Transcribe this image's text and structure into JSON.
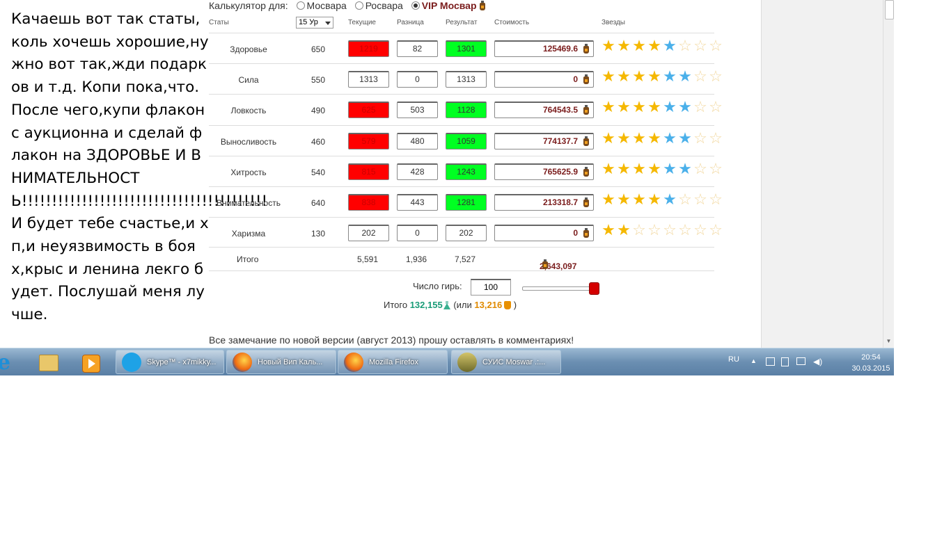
{
  "note": {
    "text": "Качаешь вот так статы,коль хочешь хорошие,нужно вот так,жди подарков и т.д. Копи пока,что. После чего,купи флакон с аукционна и сделай флакон на ЗДОРОВЬЕ И ВНИМАТЕЛЬНОСТЬ!!!!!!!!!!!!!!!!!!!!!!!!!!!!!!!!!!!!!!!!! И будет тебе счастье,и хп,и неуязвимость в боях,крыс и ленина лекго будет. Послушай меня лучше."
  },
  "calculator": {
    "label": "Калькулятор для:",
    "options": [
      "Мосвара",
      "Росвара",
      "VIP Мосвар"
    ],
    "selected": "VIP Мосвар",
    "level": "15 Ур",
    "columns": {
      "stats": "Статы",
      "current": "Текущие",
      "diff": "Разница",
      "result": "Результат",
      "cost": "Стоимость",
      "stars": "Звезды"
    },
    "rows": [
      {
        "name": "Здоровье",
        "base": "650",
        "current": "1219",
        "diff": "82",
        "result": "1301",
        "cost": "125469.6",
        "highlight": true,
        "stars": {
          "gold": 4,
          "blue": 1,
          "empty": 3
        }
      },
      {
        "name": "Сила",
        "base": "550",
        "current": "1313",
        "diff": "0",
        "result": "1313",
        "cost": "0",
        "highlight": false,
        "stars": {
          "gold": 4,
          "blue": 2,
          "empty": 2
        }
      },
      {
        "name": "Ловкость",
        "base": "490",
        "current": "625",
        "diff": "503",
        "result": "1128",
        "cost": "764543.5",
        "highlight": true,
        "stars": {
          "gold": 4,
          "blue": 2,
          "empty": 2
        }
      },
      {
        "name": "Выносливость",
        "base": "460",
        "current": "579",
        "diff": "480",
        "result": "1059",
        "cost": "774137.7",
        "highlight": true,
        "stars": {
          "gold": 4,
          "blue": 2,
          "empty": 2
        }
      },
      {
        "name": "Хитрость",
        "base": "540",
        "current": "815",
        "diff": "428",
        "result": "1243",
        "cost": "765625.9",
        "highlight": true,
        "stars": {
          "gold": 4,
          "blue": 2,
          "empty": 2
        }
      },
      {
        "name": "Внимательность",
        "base": "640",
        "current": "838",
        "diff": "443",
        "result": "1281",
        "cost": "213318.7",
        "highlight": true,
        "stars": {
          "gold": 4,
          "blue": 1,
          "empty": 3
        }
      },
      {
        "name": "Харизма",
        "base": "130",
        "current": "202",
        "diff": "0",
        "result": "202",
        "cost": "0",
        "highlight": false,
        "stars": {
          "gold": 2,
          "blue": 0,
          "empty": 6
        }
      }
    ],
    "totals": {
      "label": "Итого",
      "current": "5,591",
      "diff": "1,936",
      "result": "7,527",
      "cost": "2,643,097"
    },
    "weights_label": "Число гирь:",
    "weights_value": "100",
    "weights_slider": 1.0,
    "summary": {
      "prefix": "Итого",
      "value1": "132,155",
      "open": "(или",
      "value2": "13,216",
      "close": ")"
    },
    "comment": "Все замечание по новой версии (август 2013) прошу оставлять в комментариях!"
  },
  "taskbar": {
    "buttons": [
      {
        "label": "Skype™ - x7mikky...",
        "icon": "skype-icon"
      },
      {
        "label": "Новый Вип Каль...",
        "icon": "firefox-icon"
      },
      {
        "label": "Mozilla Firefox",
        "icon": "firefox-icon"
      },
      {
        "label": "СУИС Moswar   .:...",
        "icon": "suis-icon"
      }
    ],
    "lang": "RU",
    "time": "20:54",
    "date": "30.03.2015"
  }
}
